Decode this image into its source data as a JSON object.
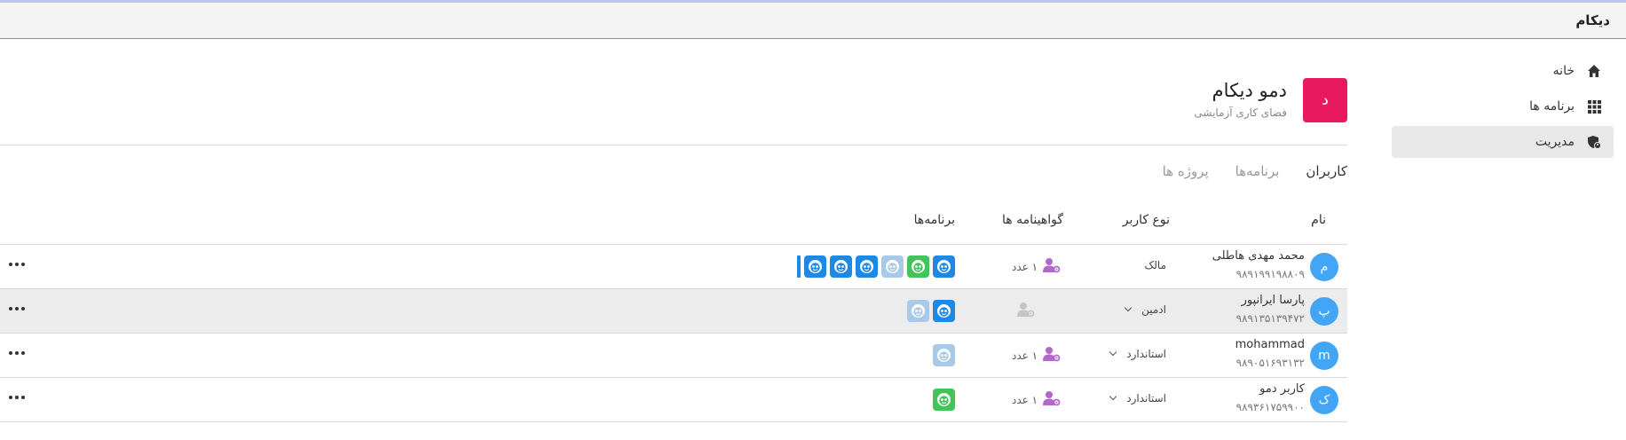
{
  "app": {
    "title": "دیکام"
  },
  "sidebar": {
    "items": [
      {
        "label": "خانه",
        "icon": "home-icon"
      },
      {
        "label": "برنامه ها",
        "icon": "apps-grid-icon"
      },
      {
        "label": "مدیریت",
        "icon": "admin-shield-icon",
        "active": true
      }
    ]
  },
  "workspace": {
    "initial": "د",
    "title": "دمو دیکام",
    "subtitle": "فضای کاری آزمایشی",
    "color": "#e8195e"
  },
  "tabs": [
    {
      "label": "کاربران",
      "active": true
    },
    {
      "label": "برنامه‌ها",
      "active": false
    },
    {
      "label": "پروژه ها",
      "active": false
    }
  ],
  "table": {
    "headers": {
      "name": "نام",
      "type": "نوع کاربر",
      "certs": "گواهینامه ها",
      "apps": "برنامه‌ها"
    },
    "rows": [
      {
        "initial": "م",
        "name": "محمد مهدی هاطلی",
        "phone": "۹۸۹۱۹۹۱۹۸۸۰۹",
        "type": "مالک",
        "dropdown": false,
        "certs": "۱ عدد",
        "cert_active": true,
        "apps": [
          "blue",
          "green",
          "pale",
          "blue",
          "blue",
          "blue"
        ],
        "truncated": true
      },
      {
        "initial": "پ",
        "name": "پارسا ایرانپور",
        "phone": "۹۸۹۱۳۵۱۳۹۴۷۲",
        "type": "ادمین",
        "dropdown": true,
        "certs": "",
        "cert_active": false,
        "apps": [
          "blue",
          "pale"
        ],
        "truncated": false,
        "highlight": true
      },
      {
        "initial": "m",
        "name": "mohammad",
        "phone": "۹۸۹۰۵۱۶۹۳۱۳۲",
        "type": "استاندارد",
        "dropdown": true,
        "certs": "۱ عدد",
        "cert_active": true,
        "apps": [
          "pale"
        ],
        "truncated": false
      },
      {
        "initial": "ک",
        "name": "کاربر دمو",
        "phone": "۹۸۹۳۶۱۷۵۹۹۰۰",
        "type": "استاندارد",
        "dropdown": true,
        "certs": "۱ عدد",
        "cert_active": true,
        "apps": [
          "green"
        ],
        "truncated": false
      }
    ]
  },
  "colors": {
    "app_blue": "#1e88e5",
    "app_green": "#43c45a",
    "app_pale": "#a9c9e8",
    "cert_purple": "#b168c9",
    "avatar_blue": "#42a5f5"
  }
}
